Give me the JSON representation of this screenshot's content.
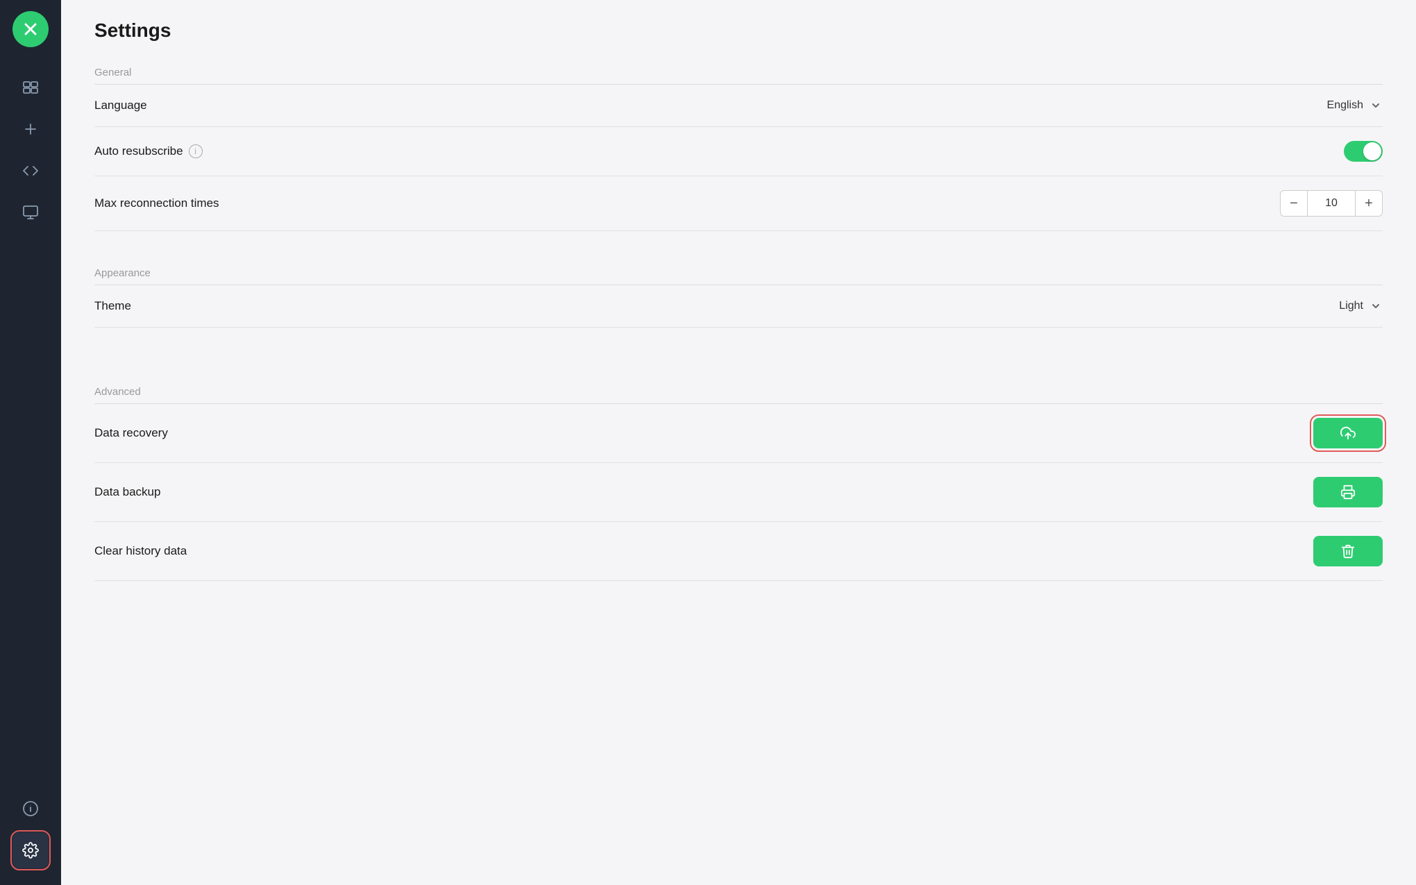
{
  "app": {
    "title": "Settings"
  },
  "sidebar": {
    "logo_icon": "×",
    "items": [
      {
        "id": "screens",
        "icon": "screens",
        "active": false
      },
      {
        "id": "add",
        "icon": "add",
        "active": false
      },
      {
        "id": "code",
        "icon": "code",
        "active": false
      },
      {
        "id": "monitor",
        "icon": "monitor",
        "active": false
      }
    ],
    "bottom_items": [
      {
        "id": "info",
        "icon": "info",
        "active": false
      },
      {
        "id": "settings",
        "icon": "settings",
        "active": true
      }
    ]
  },
  "sections": {
    "general": {
      "label": "General",
      "rows": [
        {
          "id": "language",
          "label": "Language",
          "type": "dropdown",
          "value": "English"
        },
        {
          "id": "auto-resubscribe",
          "label": "Auto resubscribe",
          "type": "toggle",
          "value": true,
          "has_info": true
        },
        {
          "id": "max-reconnection",
          "label": "Max reconnection times",
          "type": "stepper",
          "value": 10
        }
      ]
    },
    "appearance": {
      "label": "Appearance",
      "rows": [
        {
          "id": "theme",
          "label": "Theme",
          "type": "dropdown",
          "value": "Light"
        }
      ]
    },
    "advanced": {
      "label": "Advanced",
      "rows": [
        {
          "id": "data-recovery",
          "label": "Data recovery",
          "type": "upload-btn",
          "highlighted": true
        },
        {
          "id": "data-backup",
          "label": "Data backup",
          "type": "print-btn"
        },
        {
          "id": "clear-history",
          "label": "Clear history data",
          "type": "delete-btn"
        }
      ]
    }
  }
}
